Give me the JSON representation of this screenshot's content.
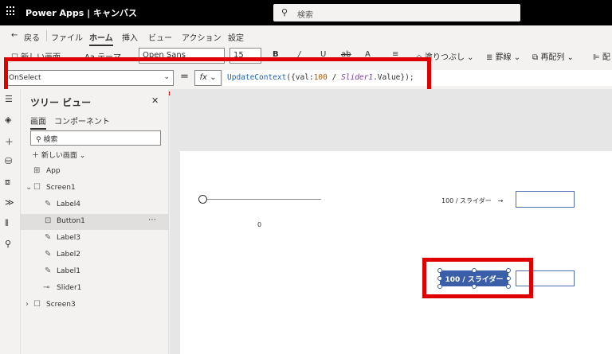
{
  "titlebar": {
    "app": "Power Apps",
    "separator": "|",
    "mode": "キャンバス",
    "search_placeholder": "検索"
  },
  "menu": {
    "back": "戻る",
    "file": "ファイル",
    "home": "ホーム",
    "insert": "挿入",
    "view": "ビュー",
    "action": "アクション",
    "settings": "設定"
  },
  "toolbar": {
    "new_screen": "新しい画面",
    "theme": "テーマ",
    "font": "Open Sans",
    "font_size": "15",
    "bold": "B",
    "italic": "/",
    "underline": "U",
    "strike": "ab",
    "font_color": "A",
    "align": "≡",
    "fill": "塗りつぶし",
    "border": "罫線",
    "reorder": "再配列",
    "align2": "配"
  },
  "formula_bar": {
    "property": "OnSelect",
    "equals": "=",
    "fx": "fx",
    "formula_fn": "UpdateContext",
    "formula_open": "({val:",
    "formula_num": "100",
    "formula_div": " / ",
    "formula_ctrl": "Slider1",
    "formula_close": ".Value});"
  },
  "tree_view": {
    "title": "ツリー ビュー",
    "tab_screens": "画面",
    "tab_components": "コンポーネント",
    "search_placeholder": "検索",
    "new_screen": "新しい画面",
    "items": [
      {
        "label": "App"
      },
      {
        "label": "Screen1"
      },
      {
        "label": "Label4"
      },
      {
        "label": "Button1"
      },
      {
        "label": "Label3"
      },
      {
        "label": "Label2"
      },
      {
        "label": "Label1"
      },
      {
        "label": "Slider1"
      },
      {
        "label": "Screen3"
      }
    ]
  },
  "canvas": {
    "slider_value": "0",
    "label_text": "100 / スライダー　→",
    "button_text": "100 / スライダー"
  },
  "colors": {
    "accent": "#3b5ea8",
    "highlight": "#e00000"
  }
}
